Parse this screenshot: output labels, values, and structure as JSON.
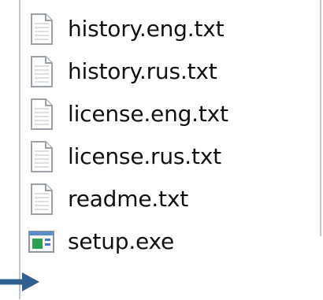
{
  "files": [
    {
      "name": "history.eng.txt",
      "icon": "text-file-icon"
    },
    {
      "name": "history.rus.txt",
      "icon": "text-file-icon"
    },
    {
      "name": "license.eng.txt",
      "icon": "text-file-icon"
    },
    {
      "name": "license.rus.txt",
      "icon": "text-file-icon"
    },
    {
      "name": "readme.txt",
      "icon": "text-file-icon"
    },
    {
      "name": "setup.exe",
      "icon": "executable-icon"
    }
  ],
  "colors": {
    "border": "#bfc6cf",
    "text": "#111111",
    "arrow": "#2f5f8f"
  }
}
